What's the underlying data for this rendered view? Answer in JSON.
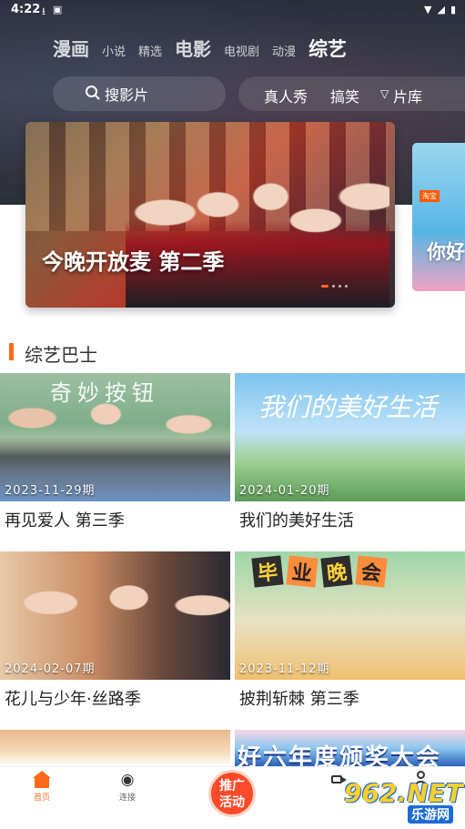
{
  "status_bar": {
    "time": "4:22"
  },
  "top_nav": {
    "items": [
      {
        "label": "漫画"
      },
      {
        "label": "小说"
      },
      {
        "label": "精选"
      },
      {
        "label": "电影"
      },
      {
        "label": "电视剧"
      },
      {
        "label": "动漫"
      },
      {
        "label": "综艺"
      }
    ],
    "active": "综艺"
  },
  "search": {
    "label": "搜影片"
  },
  "filters": {
    "items": [
      "真人秀",
      "搞笑",
      "片库"
    ]
  },
  "banner": {
    "title": "今晚开放麦 第二季",
    "next_title": "你好",
    "next_tag": "淘宝"
  },
  "section": {
    "title": "综艺巴士"
  },
  "cards": [
    {
      "title": "再见爱人 第三季",
      "date": "2023-11-29期",
      "caption": "奇妙按钮"
    },
    {
      "title": "我们的美好生活",
      "date": "2024-01-20期",
      "caption": "我们的美好生活"
    },
    {
      "title": "花儿与少年·丝路季",
      "date": "2024-02-07期",
      "caption": ""
    },
    {
      "title": "披荆斩棘 第三季",
      "date": "2023-11-12期",
      "caption": "毕业晚会"
    },
    {
      "title": "",
      "date": "",
      "caption": ""
    },
    {
      "title": "",
      "date": "",
      "caption": "好六年度颁奖大会"
    }
  ],
  "tabbar": {
    "home": "首页",
    "connect": "连接",
    "promo_line1": "推广",
    "promo_line2": "活动"
  },
  "watermark": {
    "main": "962.NET",
    "sub": "乐游网"
  },
  "colors": {
    "accent": "#ff6a1a",
    "promo": "#ff4a2a"
  }
}
